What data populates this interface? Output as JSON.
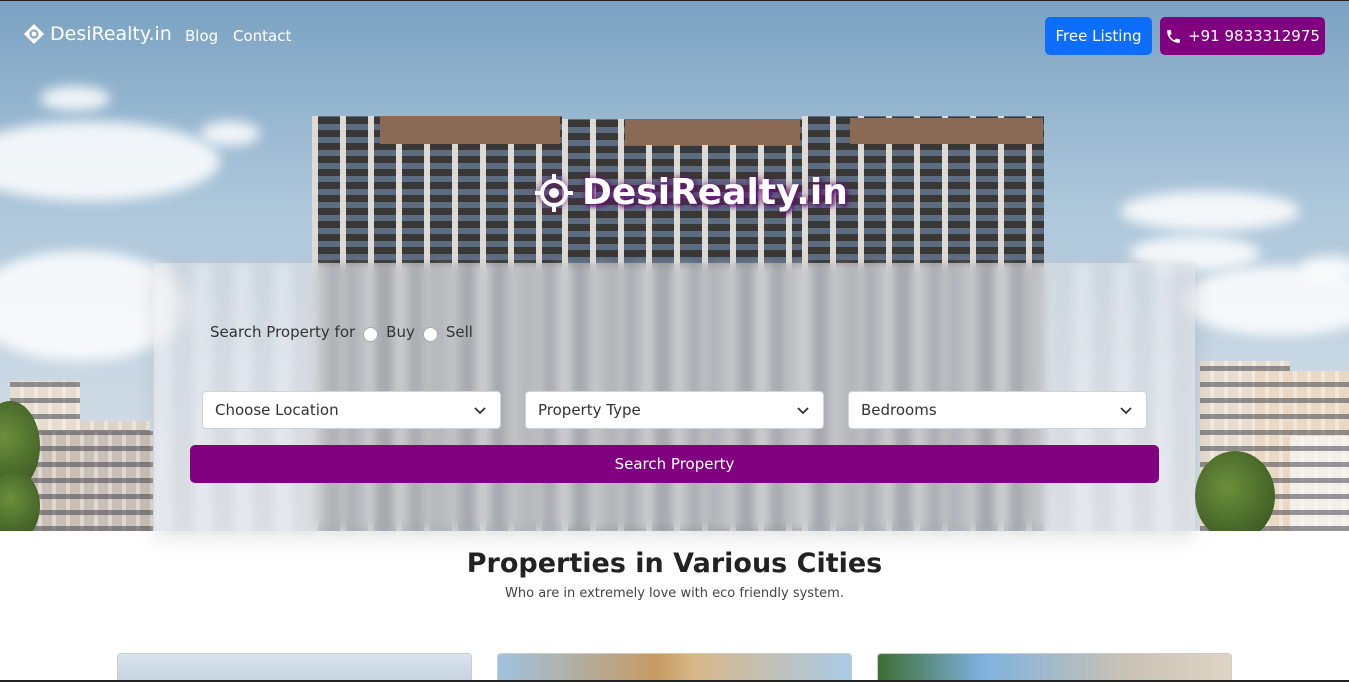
{
  "nav": {
    "brand": "DesiRealty.in",
    "links": [
      "Blog",
      "Contact"
    ],
    "free_listing": "Free Listing",
    "phone": "+91 9833312975"
  },
  "hero": {
    "logo_text": "DesiRealty.in"
  },
  "search": {
    "label": "Search Property for",
    "options": [
      "Buy",
      "Sell"
    ],
    "location_placeholder": "Choose Location",
    "type_placeholder": "Property Type",
    "bedrooms_placeholder": "Bedrooms",
    "button": "Search Property"
  },
  "section": {
    "title": "Properties in Various Cities",
    "subtitle": "Who are in extremely love with eco friendly system."
  },
  "colors": {
    "primary": "#0d6efd",
    "accent": "#800080"
  }
}
